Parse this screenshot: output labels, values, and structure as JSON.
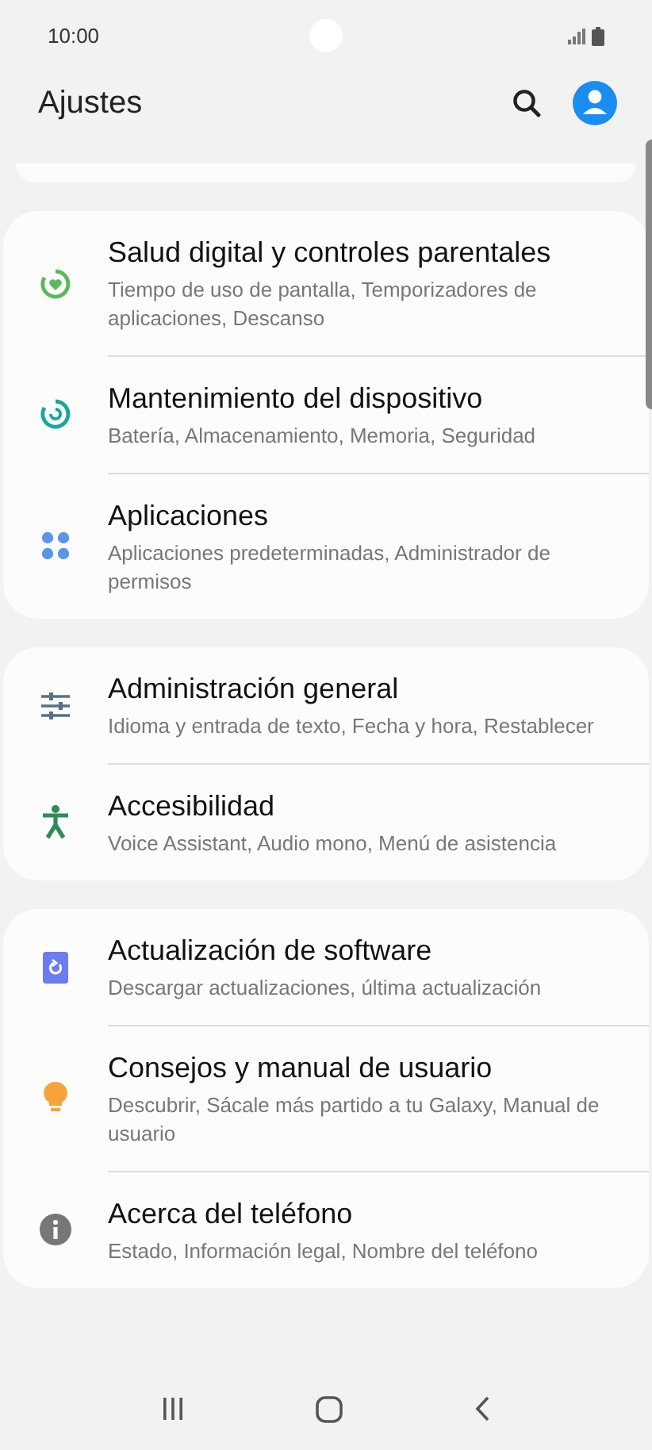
{
  "status_bar": {
    "time": "10:00"
  },
  "header": {
    "title": "Ajustes"
  },
  "groups": [
    {
      "items": [
        {
          "kind": "wellbeing",
          "title": "Salud digital y controles parentales",
          "subtitle": "Tiempo de uso de pantalla, Temporizadores de aplicaciones, Descanso"
        },
        {
          "kind": "care",
          "title": "Mantenimiento del dispositivo",
          "subtitle": "Batería, Almacenamiento, Memoria, Seguridad"
        },
        {
          "kind": "apps",
          "title": "Aplicaciones",
          "subtitle": "Aplicaciones predeterminadas, Administrador de permisos"
        }
      ]
    },
    {
      "items": [
        {
          "kind": "general",
          "title": "Administración general",
          "subtitle": "Idioma y entrada de texto, Fecha y hora, Restablecer"
        },
        {
          "kind": "accessibility",
          "title": "Accesibilidad",
          "subtitle": "Voice Assistant, Audio mono, Menú de asistencia"
        }
      ]
    },
    {
      "items": [
        {
          "kind": "update",
          "title": "Actualización de software",
          "subtitle": "Descargar actualizaciones, última actualización"
        },
        {
          "kind": "tips",
          "title": "Consejos y manual de usuario",
          "subtitle": "Descubrir, Sácale más partido a tu Galaxy, Manual de usuario"
        },
        {
          "kind": "about",
          "title": "Acerca del teléfono",
          "subtitle": "Estado, Información legal, Nombre del teléfono"
        }
      ]
    }
  ]
}
